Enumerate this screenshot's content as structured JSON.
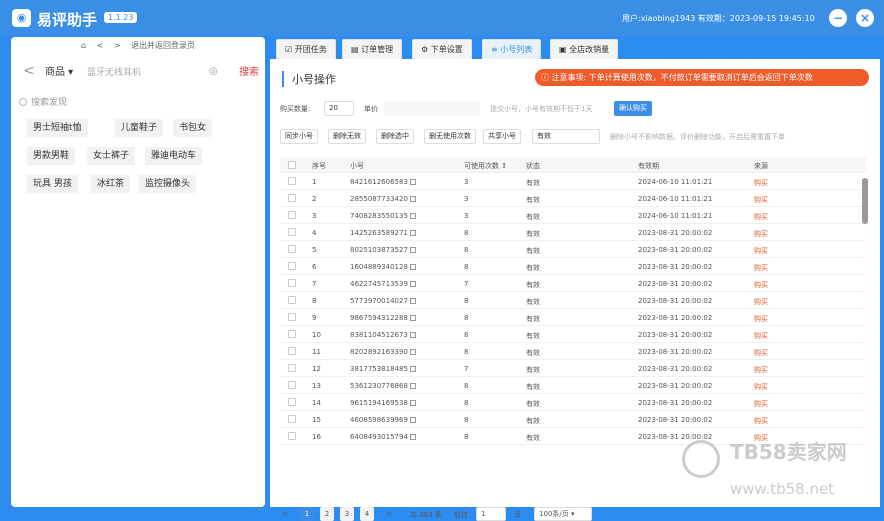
{
  "app": {
    "title": "易评助手",
    "version": "1.1.23",
    "user_info": "用户:xiaobing1943  有效期：2023-09-15 19:45:10"
  },
  "window": {
    "minimize": "−",
    "close": "×"
  },
  "left": {
    "nav": {
      "home": "⌂",
      "prev": "<",
      "next": ">",
      "text": "退出并返回登录页"
    },
    "search": {
      "back": "<",
      "category": "商品 ▾",
      "placeholder": "蓝牙无线耳机",
      "camera": "◎",
      "button": "搜索"
    },
    "find_title": "搜索发现",
    "tags": [
      "男士短袖t恤",
      "儿童鞋子",
      "书包女",
      "男款男鞋",
      "女士裤子",
      "雅迪电动车",
      "玩具 男孩",
      "冰红茶",
      "监控摄像头"
    ]
  },
  "tabs": [
    "开团任务",
    "订单管理",
    "下单设置",
    "小号列表",
    "全店改销量"
  ],
  "tab_icons": [
    "☑",
    "▤",
    "⚙",
    "≡",
    "▣"
  ],
  "panel": {
    "title": "小号操作",
    "notice": "注意事项: 下单计算使用次数，不付款订单需要取消订单后会返回下单次数",
    "buy_label": "购买数量:",
    "buy_qty": "20",
    "unit_label": "单价",
    "buy_hint": "提交小号，小号有效期不低于1天",
    "confirm_buy": "确认购买",
    "buttons": [
      "同步小号",
      "删除无效",
      "删除选中",
      "删无使用次数",
      "共享小号"
    ],
    "share_select": "有效",
    "share_hint": "删除小号不影响数据，评价删除功能，开启后需重置下单"
  },
  "table": {
    "headers": [
      "序号",
      "小号",
      "可使用次数 ↕",
      "状态",
      "有效期",
      "来源"
    ],
    "rows": [
      [
        "1",
        "8421612606583",
        "3",
        "有效",
        "2024-06-10 11:01:21",
        "购买"
      ],
      [
        "2",
        "2855087733420",
        "3",
        "有效",
        "2024-06-10 11:01:21",
        "购买"
      ],
      [
        "3",
        "7408283550135",
        "3",
        "有效",
        "2024-06-10 11:01:21",
        "购买"
      ],
      [
        "4",
        "1425263589271",
        "8",
        "有效",
        "2023-08-31 20:00:02",
        "购买"
      ],
      [
        "5",
        "8025103873527",
        "8",
        "有效",
        "2023-08-31 20:00:02",
        "购买"
      ],
      [
        "6",
        "1604889340128",
        "8",
        "有效",
        "2023-08-31 20:00:02",
        "购买"
      ],
      [
        "7",
        "4622745713539",
        "7",
        "有效",
        "2023-08-31 20:00:02",
        "购买"
      ],
      [
        "8",
        "5773970014027",
        "8",
        "有效",
        "2023-08-31 20:00:02",
        "购买"
      ],
      [
        "9",
        "9867594312288",
        "8",
        "有效",
        "2023-08-31 20:00:02",
        "购买"
      ],
      [
        "10",
        "8381104512673",
        "8",
        "有效",
        "2023-08-31 20:00:02",
        "购买"
      ],
      [
        "11",
        "8202892163390",
        "8",
        "有效",
        "2023-08-31 20:00:02",
        "购买"
      ],
      [
        "12",
        "3817753818485",
        "7",
        "有效",
        "2023-08-31 20:00:02",
        "购买"
      ],
      [
        "13",
        "5361230776868",
        "8",
        "有效",
        "2023-08-31 20:00:02",
        "购买"
      ],
      [
        "14",
        "9615194169538",
        "8",
        "有效",
        "2023-08-31 20:00:02",
        "购买"
      ],
      [
        "15",
        "4608598639969",
        "8",
        "有效",
        "2023-08-31 20:00:02",
        "购买"
      ],
      [
        "16",
        "6408493015794",
        "8",
        "有效",
        "2023-08-31 20:00:02",
        "购买"
      ]
    ]
  },
  "pager": {
    "prev": "<",
    "pages": [
      "1",
      "2",
      "3",
      "4"
    ],
    "next": ">",
    "total": "共 383 条",
    "goto_label": "前往",
    "goto_value": "1",
    "page_unit": "页",
    "page_size": "100条/页 ▾"
  },
  "watermark": {
    "brand": "TB58卖家网",
    "url": "www.tb58.net"
  },
  "colors": {
    "accent": "#3a8ee6",
    "notice": "#ef5b2a",
    "search": "#e4393c"
  }
}
